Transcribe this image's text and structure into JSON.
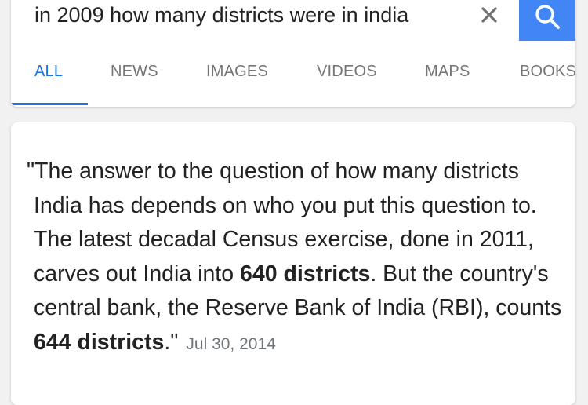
{
  "search": {
    "query": "in 2009 how many districts were in india",
    "clear_icon": "close-icon",
    "search_icon": "search-icon",
    "accent_color": "#4285f4"
  },
  "tabs": [
    {
      "label": "ALL",
      "active": true
    },
    {
      "label": "NEWS",
      "active": false
    },
    {
      "label": "IMAGES",
      "active": false
    },
    {
      "label": "VIDEOS",
      "active": false
    },
    {
      "label": "MAPS",
      "active": false
    },
    {
      "label": "BOOKS",
      "active": false
    }
  ],
  "answer": {
    "text_1": "\"The answer to the question of how many districts India has depends on who you put this question to. The latest decadal Census exercise, done in 2011, carves out India into ",
    "bold_1": "640 districts",
    "text_2": ". But the country's central bank, the Reserve Bank of India (RBI), counts ",
    "bold_2": "644 districts",
    "text_3": ".\"",
    "date": "Jul 30, 2014"
  }
}
